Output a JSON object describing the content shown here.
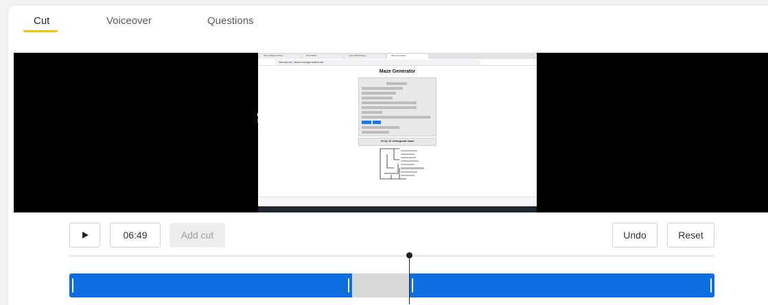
{
  "tabs": [
    {
      "label": "Cut",
      "active": true
    },
    {
      "label": "Voiceover",
      "active": false
    },
    {
      "label": "Questions",
      "active": false
    }
  ],
  "accent_color": "#f5c300",
  "segment_color": "#0d6ee0",
  "video": {
    "browser_tabs": [
      "Inbox (Shared Inbox) ...",
      "Docs Editor ...",
      "Learn Web Design ...",
      "Maze Generator"
    ],
    "address": "Not secure | www.mazegenerator.net",
    "page_title": "Maze Generator",
    "result_title": "10 by 10 orthogonal maze"
  },
  "controls": {
    "play_icon": "play-icon",
    "time": "06:49",
    "add_cut_label": "Add cut",
    "add_cut_enabled": false,
    "undo_label": "Undo",
    "reset_label": "Reset"
  },
  "timeline": {
    "playhead_fraction": 0.527,
    "segments": [
      {
        "start": 0.0,
        "end": 0.438,
        "kept": true
      },
      {
        "start": 0.438,
        "end": 0.527,
        "kept": false
      },
      {
        "start": 0.527,
        "end": 1.0,
        "kept": true
      }
    ]
  }
}
